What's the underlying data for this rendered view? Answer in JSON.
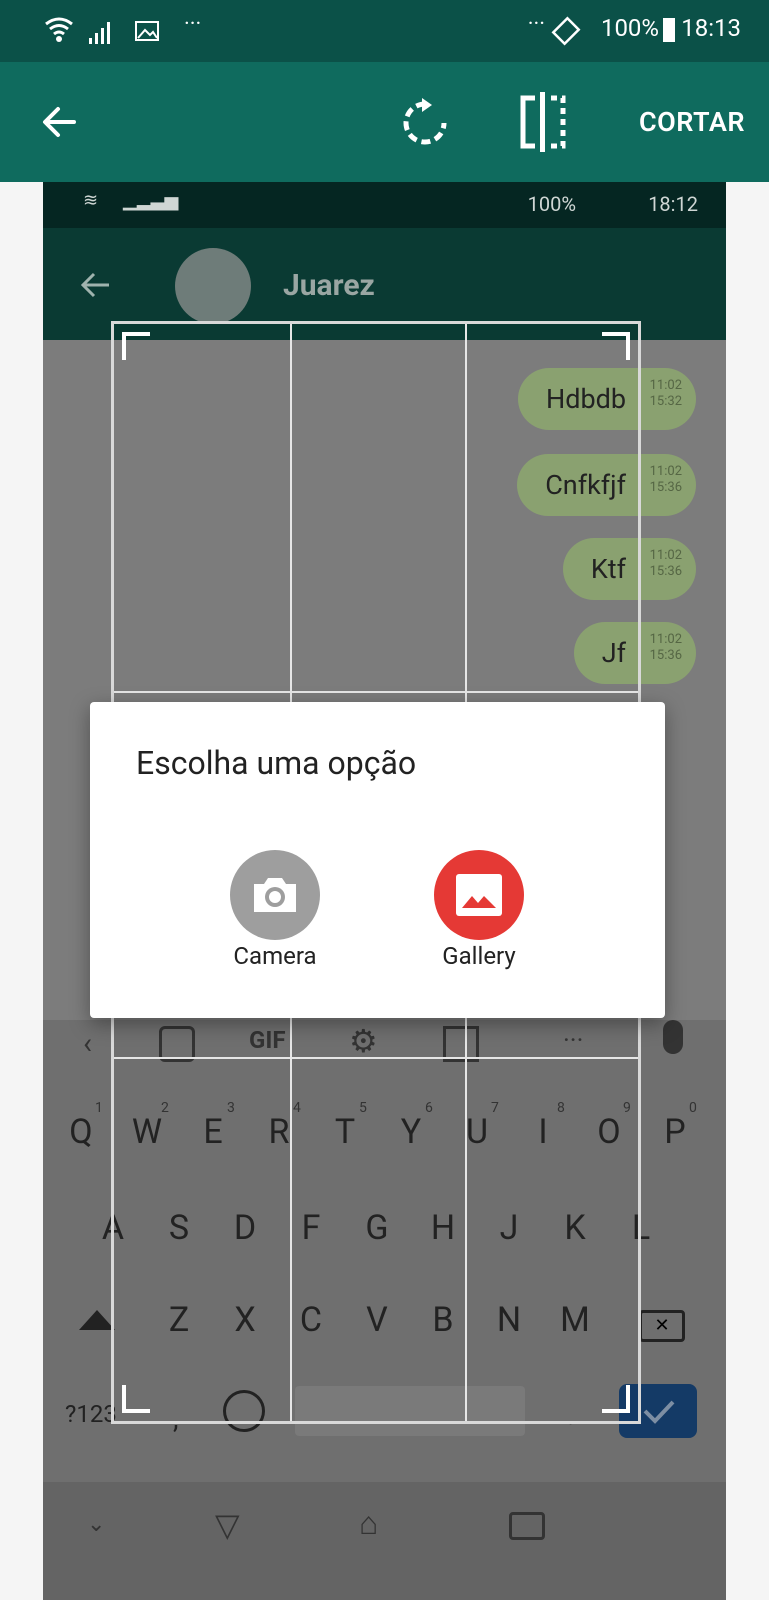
{
  "status_bar": {
    "battery": "100%",
    "time": "18:13"
  },
  "app_bar": {
    "crop_label": "CORTAR"
  },
  "screenshot": {
    "status_bar": {
      "battery": "100%",
      "time": "18:12"
    },
    "contact_name": "Juarez",
    "messages": [
      {
        "text": "Hdbdb",
        "time1": "11:02",
        "time2": "15:32"
      },
      {
        "text": "Cnfkfjf",
        "time1": "11:02",
        "time2": "15:36"
      },
      {
        "text": "Ktf",
        "time1": "11:02",
        "time2": "15:36"
      },
      {
        "text": "Jf",
        "time1": "11:02",
        "time2": "15:36"
      }
    ],
    "keyboard": {
      "toolbar": [
        "GIF"
      ],
      "row1": [
        "Q",
        "W",
        "E",
        "R",
        "T",
        "Y",
        "U",
        "I",
        "O",
        "P"
      ],
      "row1_nums": [
        "1",
        "2",
        "3",
        "4",
        "5",
        "6",
        "7",
        "8",
        "9",
        "0"
      ],
      "row2": [
        "A",
        "S",
        "D",
        "F",
        "G",
        "H",
        "J",
        "K",
        "L"
      ],
      "row3": [
        "Z",
        "X",
        "C",
        "V",
        "B",
        "N",
        "M"
      ],
      "symbols": "?123",
      "comma": ",",
      "period": "."
    }
  },
  "dialog": {
    "title": "Escolha uma opção",
    "camera_label": "Camera",
    "gallery_label": "Gallery"
  }
}
